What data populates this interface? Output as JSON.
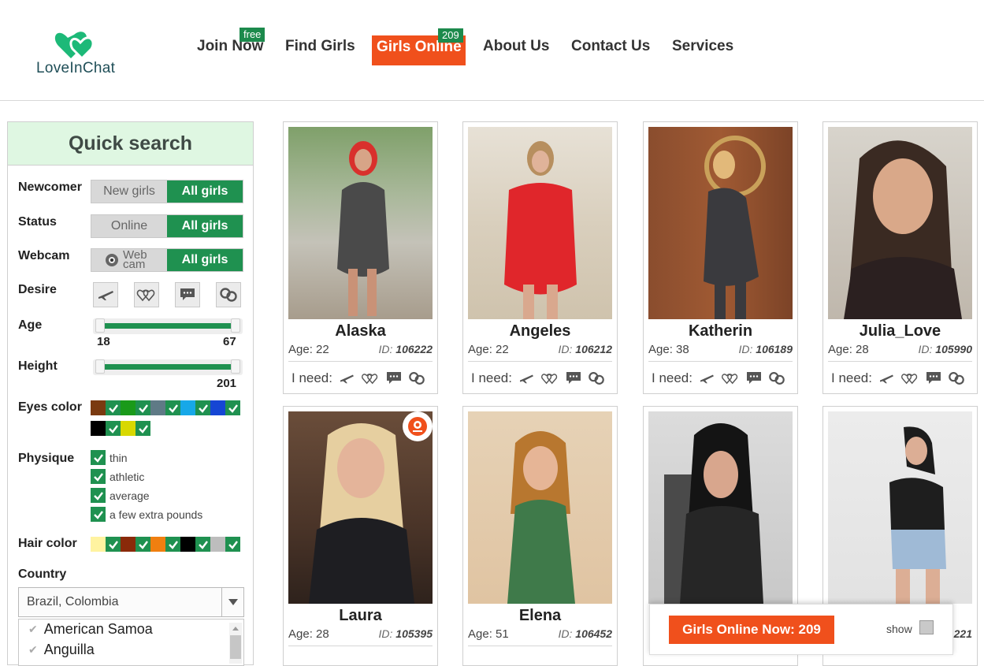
{
  "brand": {
    "name": "LoveInChat",
    "color": "#1db978"
  },
  "nav": {
    "join": "Join Now",
    "join_badge": "free",
    "find": "Find Girls",
    "online": "Girls Online",
    "online_badge": "209",
    "about": "About Us",
    "contact": "Contact Us",
    "services": "Services"
  },
  "sidebar": {
    "title": "Quick search",
    "newcomer": {
      "label": "Newcomer",
      "off": "New girls",
      "on": "All girls"
    },
    "status": {
      "label": "Status",
      "off": "Online",
      "on": "All girls"
    },
    "webcam": {
      "label": "Webcam",
      "off": "Web cam",
      "on": "All girls"
    },
    "desire": {
      "label": "Desire",
      "icons": [
        "plane-icon",
        "hearts-icon",
        "chat-icon",
        "correspondence-icon"
      ]
    },
    "age": {
      "label": "Age",
      "min": "18",
      "max": "67"
    },
    "height": {
      "label": "Height",
      "max": "201"
    },
    "eyes": {
      "label": "Eyes color",
      "colors": [
        "#7a3a10",
        "#1a9a1a",
        "#5f7a86",
        "#17a8e8",
        "#1546d4",
        "#000000",
        "#d8d800"
      ]
    },
    "physique": {
      "label": "Physique",
      "options": [
        "thin",
        "athletic",
        "average",
        "a few extra pounds"
      ]
    },
    "hair": {
      "label": "Hair color",
      "colors": [
        "#fff3a0",
        "#8a2a0a",
        "#f07f10",
        "#000000",
        "#bdbdbd"
      ]
    },
    "country": {
      "label": "Country",
      "selected": "Brazil, Colombia",
      "options": [
        "American Samoa",
        "Anguilla"
      ]
    }
  },
  "cards": {
    "need_label": "I need:",
    "age_prefix": "Age:",
    "id_prefix": "ID:",
    "items": [
      {
        "name": "Alaska",
        "age": "22",
        "id": "106222"
      },
      {
        "name": "Angeles",
        "age": "22",
        "id": "106212"
      },
      {
        "name": "Katherin",
        "age": "38",
        "id": "106189"
      },
      {
        "name": "Julia_Love",
        "age": "28",
        "id": "105990"
      },
      {
        "name": "Laura",
        "age": "28",
        "id": "105395"
      },
      {
        "name": "Elena",
        "age": "51",
        "id": "106452"
      },
      {
        "name": "",
        "age": "",
        "id": ""
      },
      {
        "name": "",
        "age": "",
        "id": "221"
      }
    ]
  },
  "online_bar": {
    "button": "Girls Online Now: 209",
    "show": "show"
  }
}
